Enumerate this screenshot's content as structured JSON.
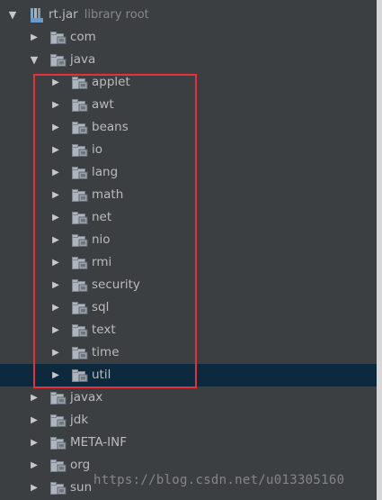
{
  "tree": {
    "root": {
      "label": "rt.jar",
      "sublabel": "library root",
      "icon": "jar-icon",
      "expanded": true
    },
    "level1": [
      {
        "label": "com",
        "expanded": false
      },
      {
        "label": "java",
        "expanded": true
      }
    ],
    "java_children": [
      {
        "label": "applet"
      },
      {
        "label": "awt"
      },
      {
        "label": "beans"
      },
      {
        "label": "io"
      },
      {
        "label": "lang"
      },
      {
        "label": "math"
      },
      {
        "label": "net"
      },
      {
        "label": "nio"
      },
      {
        "label": "rmi"
      },
      {
        "label": "security"
      },
      {
        "label": "sql"
      },
      {
        "label": "text"
      },
      {
        "label": "time"
      },
      {
        "label": "util",
        "selected": true
      }
    ],
    "level1_after": [
      {
        "label": "javax"
      },
      {
        "label": "jdk"
      },
      {
        "label": "META-INF"
      },
      {
        "label": "org"
      },
      {
        "label": "sun"
      }
    ]
  },
  "watermark": "https://blog.csdn.net/u013305160",
  "colors": {
    "background": "#3c3f41",
    "selection": "#0d293e",
    "highlight_box": "#e8303a",
    "text": "#bbbbbb"
  }
}
